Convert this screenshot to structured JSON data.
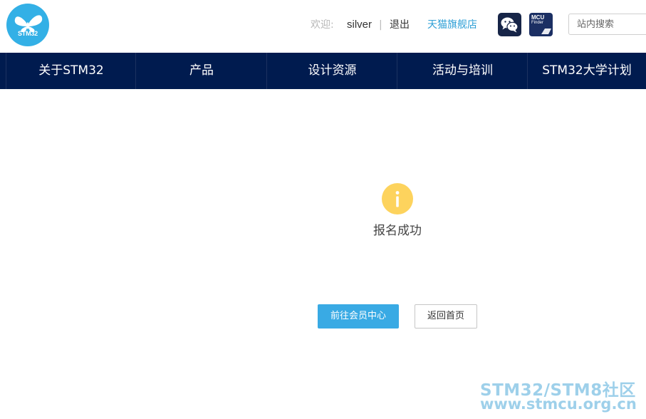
{
  "header": {
    "logo_text": "STM32",
    "welcome_label": "欢迎:",
    "username": "silver",
    "separator": "|",
    "logout_label": "退出",
    "store_link": "天猫旗舰店",
    "mcu_finder_title": "MCU",
    "mcu_finder_subtitle": "Finder",
    "search_placeholder": "站内搜索"
  },
  "nav": {
    "items": [
      {
        "label": "关于STM32"
      },
      {
        "label": "产品"
      },
      {
        "label": "设计资源"
      },
      {
        "label": "活动与培训"
      },
      {
        "label": "STM32大学计划"
      }
    ]
  },
  "main": {
    "message": "报名成功",
    "primary_button": "前往会员中心",
    "secondary_button": "返回首页"
  },
  "watermark": {
    "line1": "STM32/STM8社区",
    "line2": "www.stmcu.org.cn"
  },
  "colors": {
    "nav_bg": "#001b4f",
    "brand_blue": "#33b0e6",
    "info_yellow": "#fdd35d",
    "primary_button": "#39aae4"
  },
  "icons": {
    "logo": "butterfly-logo-icon",
    "wechat": "wechat-icon",
    "info": "info-icon"
  }
}
